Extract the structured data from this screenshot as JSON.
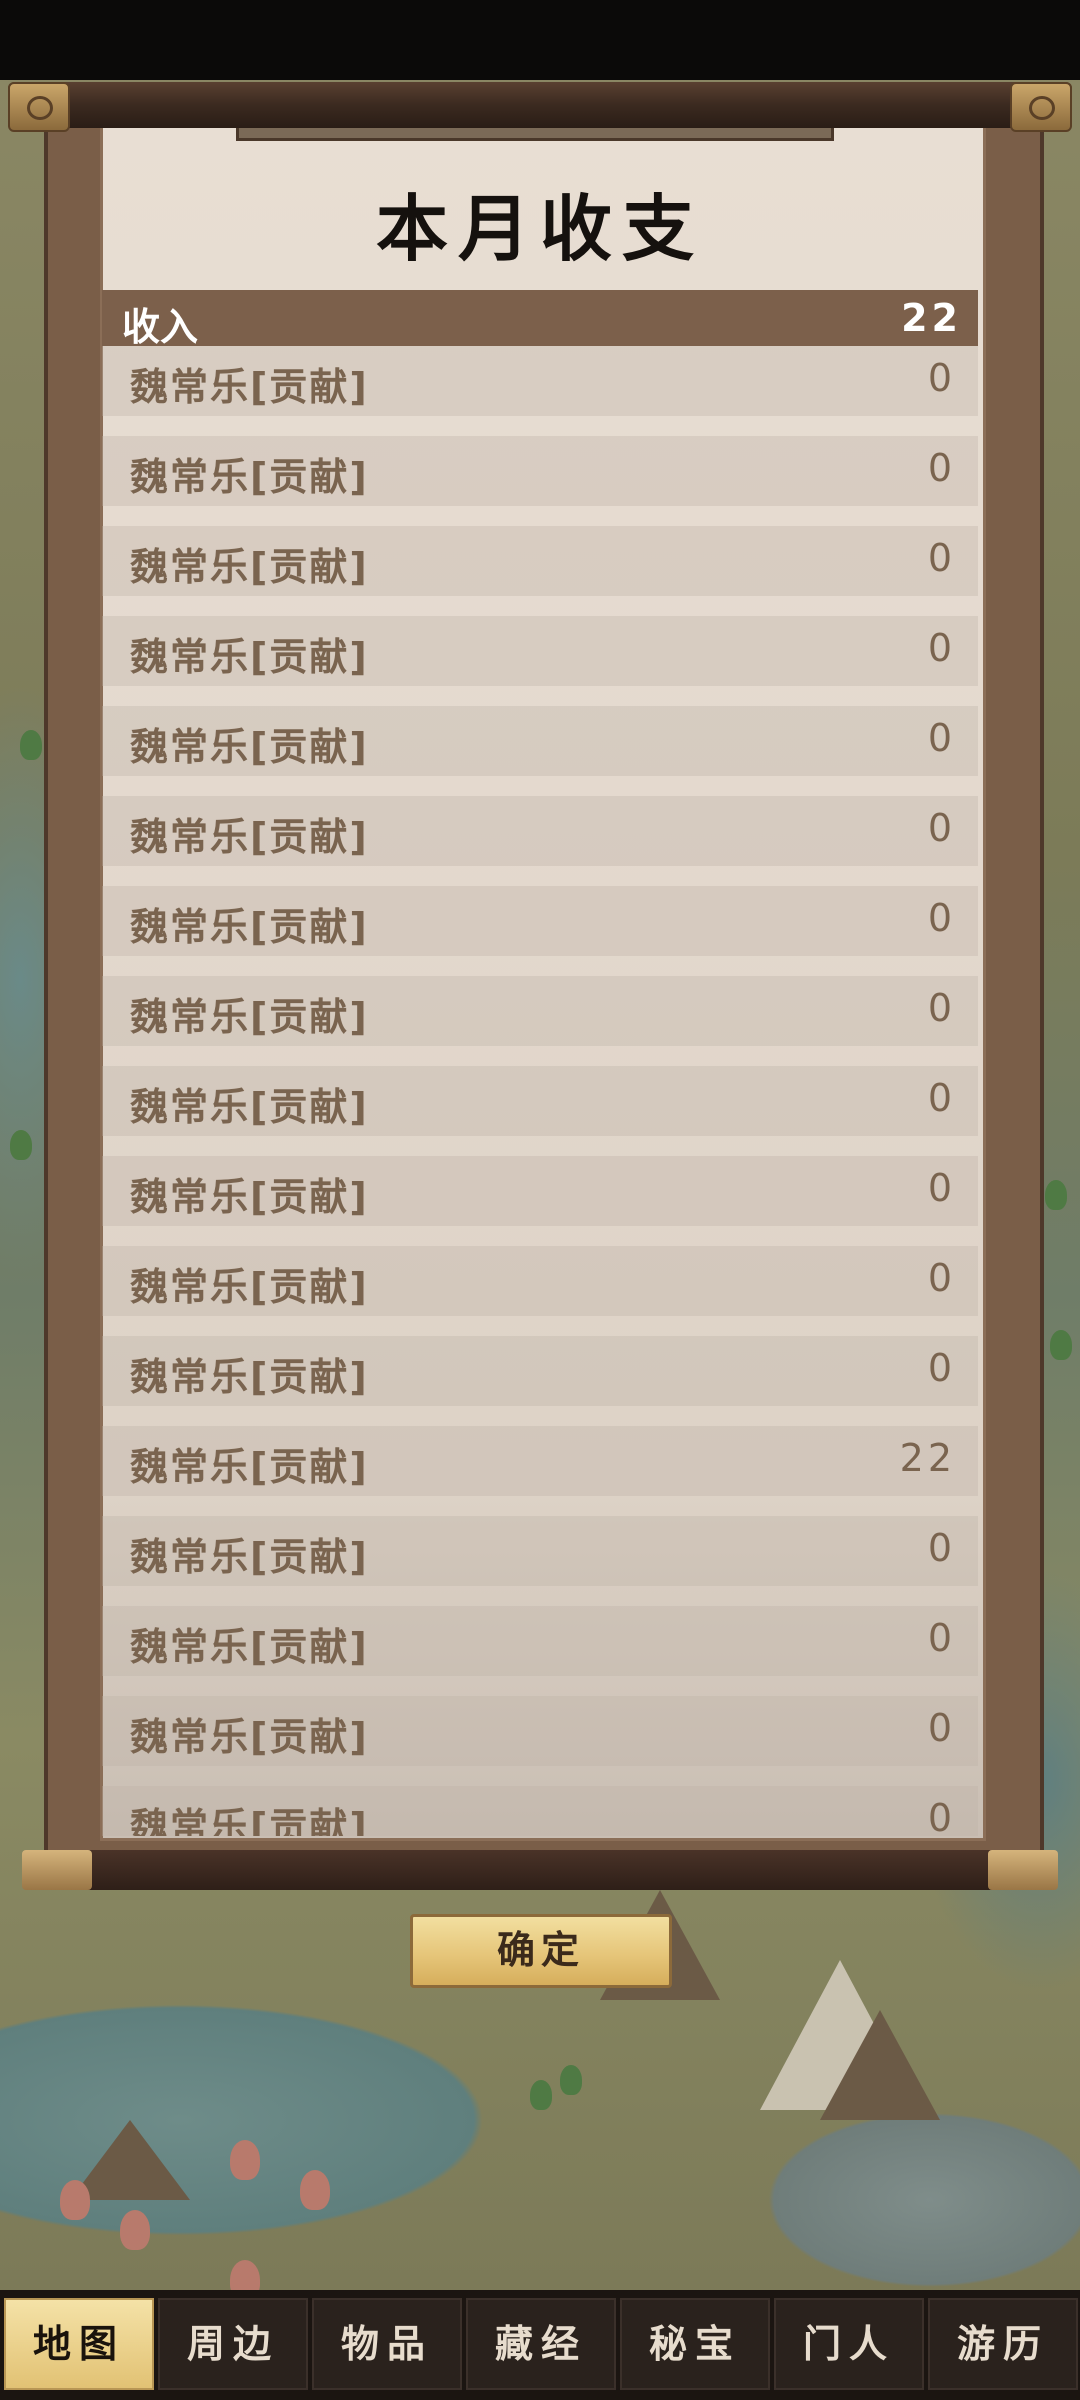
{
  "dialog": {
    "title": "本月收支",
    "income_header": {
      "label": "收入",
      "value": "22"
    },
    "rows": [
      {
        "name": "魏常乐[贡献]",
        "amount": "0"
      },
      {
        "name": "魏常乐[贡献]",
        "amount": "0"
      },
      {
        "name": "魏常乐[贡献]",
        "amount": "0"
      },
      {
        "name": "魏常乐[贡献]",
        "amount": "0"
      },
      {
        "name": "魏常乐[贡献]",
        "amount": "0"
      },
      {
        "name": "魏常乐[贡献]",
        "amount": "0"
      },
      {
        "name": "魏常乐[贡献]",
        "amount": "0"
      },
      {
        "name": "魏常乐[贡献]",
        "amount": "0"
      },
      {
        "name": "魏常乐[贡献]",
        "amount": "0"
      },
      {
        "name": "魏常乐[贡献]",
        "amount": "0"
      },
      {
        "name": "魏常乐[贡献]",
        "amount": "0"
      },
      {
        "name": "魏常乐[贡献]",
        "amount": "0"
      },
      {
        "name": "魏常乐[贡献]",
        "amount": "22"
      },
      {
        "name": "魏常乐[贡献]",
        "amount": "0"
      },
      {
        "name": "魏常乐[贡献]",
        "amount": "0"
      },
      {
        "name": "魏常乐[贡献]",
        "amount": "0"
      },
      {
        "name": "魏常乐[贡献]",
        "amount": "0"
      }
    ],
    "confirm_label": "确定"
  },
  "nav": {
    "items": [
      {
        "label": "地图",
        "active": true
      },
      {
        "label": "周边",
        "active": false
      },
      {
        "label": "物品",
        "active": false
      },
      {
        "label": "藏经",
        "active": false
      },
      {
        "label": "秘宝",
        "active": false
      },
      {
        "label": "门人",
        "active": false
      },
      {
        "label": "游历",
        "active": false
      }
    ]
  },
  "colors": {
    "scroll_wood": "#7a5e48",
    "paper": "#e4d9ce",
    "header_bar": "#7c604b",
    "row_text": "#7a644f",
    "button_gold": "#e6c67a",
    "nav_bg": "#2a221d",
    "nav_active": "#f4e2a7"
  }
}
